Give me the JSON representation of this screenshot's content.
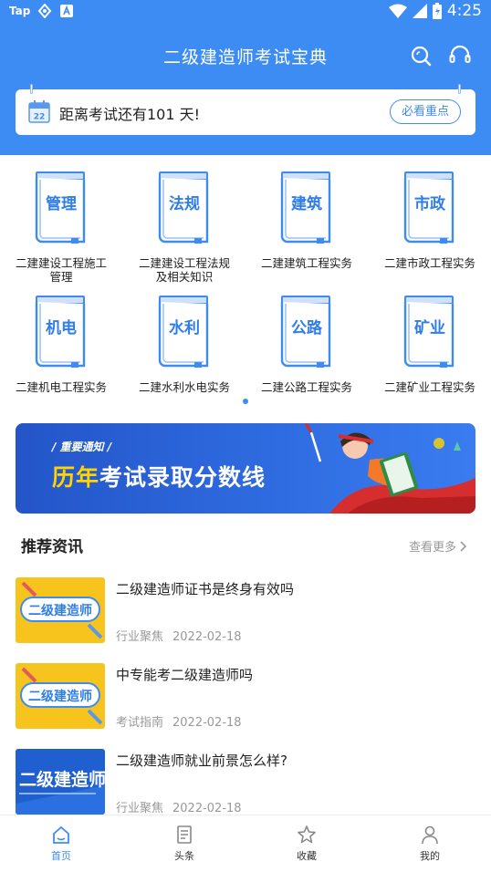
{
  "status_bar": {
    "app_label": "Tap",
    "time": "4:25"
  },
  "header": {
    "title": "二级建造师考试宝典"
  },
  "exam_card": {
    "countdown": "距离考试还有101 天!",
    "button": "必看重点",
    "calendar_day": "22"
  },
  "subjects": [
    {
      "label": "管理",
      "name": "二建建设工程施工\n管理"
    },
    {
      "label": "法规",
      "name": "二建建设工程法规\n及相关知识"
    },
    {
      "label": "建筑",
      "name": "二建建筑工程实务"
    },
    {
      "label": "市政",
      "name": "二建市政工程实务"
    },
    {
      "label": "机电",
      "name": "二建机电工程实务"
    },
    {
      "label": "水利",
      "name": "二建水利水电实务"
    },
    {
      "label": "公路",
      "name": "二建公路工程实务"
    },
    {
      "label": "矿业",
      "name": "二建矿业工程实务"
    }
  ],
  "banner": {
    "subtitle": "/ 重要通知 /",
    "title_highlight": "历年",
    "title_rest": "考试录取分数线"
  },
  "news_section": {
    "title": "推荐资讯",
    "more": "查看更多"
  },
  "news": [
    {
      "title": "二级建造师证书是终身有效吗",
      "category": "行业聚焦",
      "date": "2022-02-18",
      "thumb_text": "二级建造师",
      "thumb_style": "yellow"
    },
    {
      "title": "中专能考二级建造师吗",
      "category": "考试指南",
      "date": "2022-02-18",
      "thumb_text": "二级建造师",
      "thumb_style": "yellow"
    },
    {
      "title": "二级建造师就业前景怎么样?",
      "category": "行业聚焦",
      "date": "2022-02-18",
      "thumb_text": "二级建造师",
      "thumb_style": "blue"
    }
  ],
  "tabbar": [
    {
      "label": "首页",
      "icon": "home-icon",
      "active": true
    },
    {
      "label": "头条",
      "icon": "news-icon",
      "active": false
    },
    {
      "label": "收藏",
      "icon": "star-icon",
      "active": false
    },
    {
      "label": "我的",
      "icon": "person-icon",
      "active": false
    }
  ],
  "colors": {
    "primary": "#3d8cf4",
    "highlight": "#ffd400"
  }
}
